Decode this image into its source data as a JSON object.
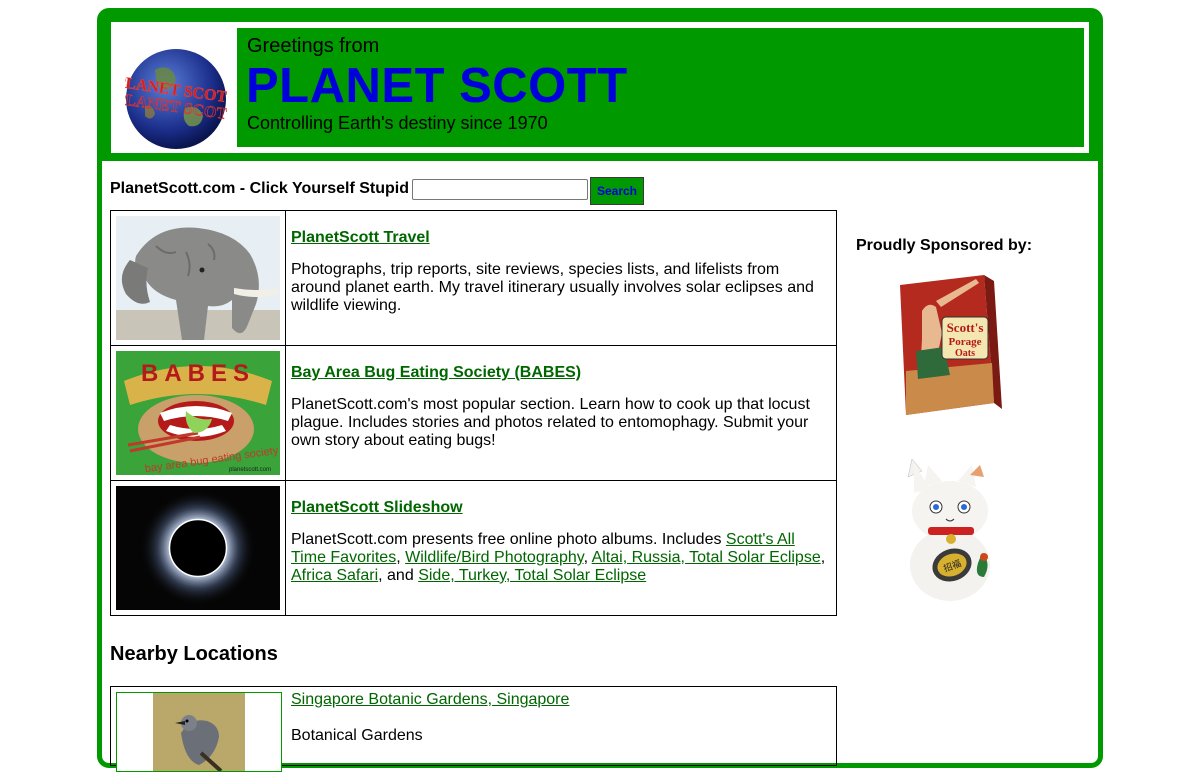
{
  "header": {
    "logo_text": "PLANET SCOTT",
    "greeting": "Greetings from",
    "brand": "PLANET SCOTT",
    "tagline": "Controlling Earth's destiny since 1970"
  },
  "search": {
    "site_label": "PlanetScott.com - Click Yourself Stupid",
    "input_value": "",
    "button_label": "Search"
  },
  "features": [
    {
      "title": "PlanetScott Travel",
      "description": "Photographs, trip reports, site reviews, species lists, and lifelists from around planet earth. My travel itinerary usually involves solar eclipses and wildlife viewing.",
      "image": "elephant-photo"
    },
    {
      "title": "Bay Area Bug Eating Society (BABES)",
      "description": "PlanetScott.com's most popular section. Learn how to cook up that locust plague. Includes stories and photos related to entomophagy. Submit your own story about eating bugs!",
      "image": "babes-logo",
      "image_text": "BABES",
      "image_subtext": "bay area bug eating society",
      "image_credit": "planetscott.com"
    },
    {
      "title": "PlanetScott Slideshow",
      "description_prefix": "PlanetScott.com presents free online photo albums. Includes",
      "links": [
        "Scott's All Time Favorites",
        "Wildlife/Bird Photography",
        "Altai, Russia, Total Solar Eclipse",
        "Africa Safari",
        "Side, Turkey, Total Solar Eclipse"
      ],
      "sep_comma": ",",
      "sep_and": ", and",
      "image": "solar-eclipse-photo"
    }
  ],
  "nearby": {
    "heading": "Nearby Locations",
    "items": [
      {
        "name": "Singapore Botanic Gardens, Singapore",
        "category": "Botanical Gardens",
        "image": "bird-photo"
      }
    ]
  },
  "sponsors": {
    "label": "Proudly Sponsored by:",
    "oats_text_1": "Scott's",
    "oats_text_2": "Porage",
    "oats_text_3": "Oats",
    "cat_text": "招福"
  },
  "colors": {
    "frame_green": "#009900",
    "brand_blue": "#0000dd",
    "link_green": "#006600"
  }
}
